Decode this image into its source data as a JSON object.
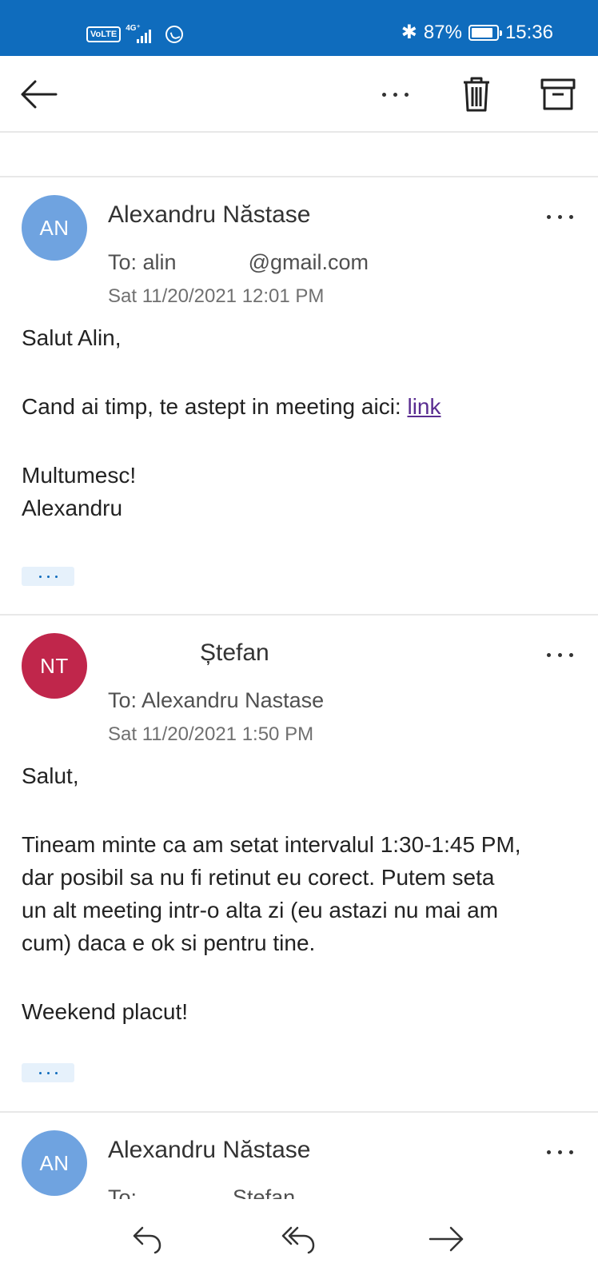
{
  "status_bar": {
    "volte": "VoLTE",
    "network": "4G⁺",
    "bluetooth_icon": "bluetooth-icon",
    "battery_percent": "87%",
    "battery_level": 0.87,
    "time": "15:36"
  },
  "toolbar": {
    "back_icon": "arrow-left-icon",
    "more_icon": "more-horizontal-icon",
    "delete_icon": "trash-icon",
    "archive_icon": "archive-icon"
  },
  "messages": [
    {
      "avatar_initials": "AN",
      "avatar_color": "#6fa3e0",
      "sender": "Alexandru Năstase",
      "to": "To: alin            @gmail.com",
      "date": "Sat 11/20/2021 12:01 PM",
      "body": {
        "greeting": "Salut Alin,",
        "line_text": "Cand ai timp, te astept in meeting aici: ",
        "link_text": "link",
        "closing_1": "Multumesc!",
        "closing_2": "Alexandru"
      }
    },
    {
      "avatar_initials": "NT",
      "avatar_color": "#c0264b",
      "sender": "Ștefan",
      "to": "To: Alexandru Nastase",
      "date": "Sat 11/20/2021 1:50 PM",
      "body": {
        "greeting": "Salut,",
        "line_1": "Tineam minte ca am setat intervalul 1:30-1:45 PM,",
        "line_2": "dar posibil sa nu fi retinut eu corect. Putem seta",
        "line_3": "un alt meeting intr-o alta zi (eu astazi nu mai am",
        "line_4": "cum) daca e ok si pentru tine.",
        "closing": "Weekend placut!"
      }
    },
    {
      "avatar_initials": "AN",
      "avatar_color": "#6fa3e0",
      "sender": "Alexandru Năstase",
      "to": "To:                Stefan"
    }
  ],
  "bottom_bar": {
    "reply_icon": "reply-icon",
    "reply_all_icon": "reply-all-icon",
    "forward_icon": "forward-icon"
  },
  "colors": {
    "status_bar": "#0f6cbd",
    "link": "#5a2d91"
  }
}
